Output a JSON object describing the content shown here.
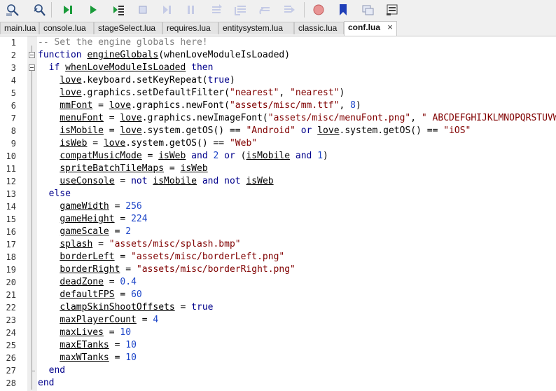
{
  "toolbar": {
    "buttons": [
      "search-icon",
      "find-in-files-icon",
      "run-all-icon",
      "run-icon",
      "run-to-cursor-icon",
      "stop-icon",
      "step-over-icon",
      "pause-icon",
      "step-into-icon",
      "step-out-icon",
      "step-back-icon",
      "step-forward-icon",
      "breakpoint-icon",
      "bookmark-icon",
      "watch-icon",
      "stack-icon"
    ]
  },
  "tabs": [
    {
      "label": "main.lua",
      "active": false
    },
    {
      "label": "console.lua",
      "active": false
    },
    {
      "label": "stageSelect.lua",
      "active": false
    },
    {
      "label": "requires.lua",
      "active": false
    },
    {
      "label": "entitysystem.lua",
      "active": false
    },
    {
      "label": "classic.lua",
      "active": false
    },
    {
      "label": "conf.lua",
      "active": true,
      "close": "×"
    }
  ],
  "editor": {
    "lines": [
      [
        [
          "cmt",
          "-- Set the engine globals here!"
        ]
      ],
      [
        [
          "kw",
          "function"
        ],
        [
          "t",
          " "
        ],
        [
          "var",
          "engineGlobals"
        ],
        [
          "t",
          "(whenLoveModuleIsLoaded)"
        ]
      ],
      [
        [
          "t",
          "  "
        ],
        [
          "kw",
          "if"
        ],
        [
          "t",
          " "
        ],
        [
          "var",
          "whenLoveModuleIsLoaded"
        ],
        [
          "t",
          " "
        ],
        [
          "kw",
          "then"
        ]
      ],
      [
        [
          "t",
          "    "
        ],
        [
          "var",
          "love"
        ],
        [
          "t",
          ".keyboard.setKeyRepeat("
        ],
        [
          "kw",
          "true"
        ],
        [
          "t",
          ")"
        ]
      ],
      [
        [
          "t",
          "    "
        ],
        [
          "var",
          "love"
        ],
        [
          "t",
          ".graphics.setDefaultFilter("
        ],
        [
          "str",
          "\"nearest\""
        ],
        [
          "t",
          ", "
        ],
        [
          "str",
          "\"nearest\""
        ],
        [
          "t",
          ")"
        ]
      ],
      [
        [
          "t",
          "    "
        ],
        [
          "var",
          "mmFont"
        ],
        [
          "t",
          " = "
        ],
        [
          "var",
          "love"
        ],
        [
          "t",
          ".graphics.newFont("
        ],
        [
          "str",
          "\"assets/misc/mm.ttf\""
        ],
        [
          "t",
          ", "
        ],
        [
          "num",
          "8"
        ],
        [
          "t",
          ")"
        ]
      ],
      [
        [
          "t",
          "    "
        ],
        [
          "var",
          "menuFont"
        ],
        [
          "t",
          " = "
        ],
        [
          "var",
          "love"
        ],
        [
          "t",
          ".graphics.newImageFont("
        ],
        [
          "str",
          "\"assets/misc/menuFont.png\""
        ],
        [
          "t",
          ", "
        ],
        [
          "str",
          "\" ABCDEFGHIJKLMNOPQRSTUVWXYZ"
        ]
      ],
      [
        [
          "t",
          "    "
        ],
        [
          "var",
          "isMobile"
        ],
        [
          "t",
          " = "
        ],
        [
          "var",
          "love"
        ],
        [
          "t",
          ".system.getOS() == "
        ],
        [
          "str",
          "\"Android\""
        ],
        [
          "t",
          " "
        ],
        [
          "kw",
          "or"
        ],
        [
          "t",
          " "
        ],
        [
          "var",
          "love"
        ],
        [
          "t",
          ".system.getOS() == "
        ],
        [
          "str",
          "\"iOS\""
        ]
      ],
      [
        [
          "t",
          "    "
        ],
        [
          "var",
          "isWeb"
        ],
        [
          "t",
          " = "
        ],
        [
          "var",
          "love"
        ],
        [
          "t",
          ".system.getOS() == "
        ],
        [
          "str",
          "\"Web\""
        ]
      ],
      [
        [
          "t",
          "    "
        ],
        [
          "var",
          "compatMusicMode"
        ],
        [
          "t",
          " = "
        ],
        [
          "var",
          "isWeb"
        ],
        [
          "t",
          " "
        ],
        [
          "kw",
          "and"
        ],
        [
          "t",
          " "
        ],
        [
          "num",
          "2"
        ],
        [
          "t",
          " "
        ],
        [
          "kw",
          "or"
        ],
        [
          "t",
          " ("
        ],
        [
          "var",
          "isMobile"
        ],
        [
          "t",
          " "
        ],
        [
          "kw",
          "and"
        ],
        [
          "t",
          " "
        ],
        [
          "num",
          "1"
        ],
        [
          "t",
          ")"
        ]
      ],
      [
        [
          "t",
          "    "
        ],
        [
          "var",
          "spriteBatchTileMaps"
        ],
        [
          "t",
          " = "
        ],
        [
          "var",
          "isWeb"
        ]
      ],
      [
        [
          "t",
          "    "
        ],
        [
          "var",
          "useConsole"
        ],
        [
          "t",
          " = "
        ],
        [
          "kw",
          "not"
        ],
        [
          "t",
          " "
        ],
        [
          "var",
          "isMobile"
        ],
        [
          "t",
          " "
        ],
        [
          "kw",
          "and"
        ],
        [
          "t",
          " "
        ],
        [
          "kw",
          "not"
        ],
        [
          "t",
          " "
        ],
        [
          "var",
          "isWeb"
        ]
      ],
      [
        [
          "t",
          "  "
        ],
        [
          "kw",
          "else"
        ]
      ],
      [
        [
          "t",
          "    "
        ],
        [
          "var",
          "gameWidth"
        ],
        [
          "t",
          " = "
        ],
        [
          "num",
          "256"
        ]
      ],
      [
        [
          "t",
          "    "
        ],
        [
          "var",
          "gameHeight"
        ],
        [
          "t",
          " = "
        ],
        [
          "num",
          "224"
        ]
      ],
      [
        [
          "t",
          "    "
        ],
        [
          "var",
          "gameScale"
        ],
        [
          "t",
          " = "
        ],
        [
          "num",
          "2"
        ]
      ],
      [
        [
          "t",
          "    "
        ],
        [
          "var",
          "splash"
        ],
        [
          "t",
          " = "
        ],
        [
          "str",
          "\"assets/misc/splash.bmp\""
        ]
      ],
      [
        [
          "t",
          "    "
        ],
        [
          "var",
          "borderLeft"
        ],
        [
          "t",
          " = "
        ],
        [
          "str",
          "\"assets/misc/borderLeft.png\""
        ]
      ],
      [
        [
          "t",
          "    "
        ],
        [
          "var",
          "borderRight"
        ],
        [
          "t",
          " = "
        ],
        [
          "str",
          "\"assets/misc/borderRight.png\""
        ]
      ],
      [
        [
          "t",
          "    "
        ],
        [
          "var",
          "deadZone"
        ],
        [
          "t",
          " = "
        ],
        [
          "num",
          "0.4"
        ]
      ],
      [
        [
          "t",
          "    "
        ],
        [
          "var",
          "defaultFPS"
        ],
        [
          "t",
          " = "
        ],
        [
          "num",
          "60"
        ]
      ],
      [
        [
          "t",
          "    "
        ],
        [
          "var",
          "clampSkinShootOffsets"
        ],
        [
          "t",
          " = "
        ],
        [
          "kw",
          "true"
        ]
      ],
      [
        [
          "t",
          "    "
        ],
        [
          "var",
          "maxPlayerCount"
        ],
        [
          "t",
          " = "
        ],
        [
          "num",
          "4"
        ]
      ],
      [
        [
          "t",
          "    "
        ],
        [
          "var",
          "maxLives"
        ],
        [
          "t",
          " = "
        ],
        [
          "num",
          "10"
        ]
      ],
      [
        [
          "t",
          "    "
        ],
        [
          "var",
          "maxETanks"
        ],
        [
          "t",
          " = "
        ],
        [
          "num",
          "10"
        ]
      ],
      [
        [
          "t",
          "    "
        ],
        [
          "var",
          "maxWTanks"
        ],
        [
          "t",
          " = "
        ],
        [
          "num",
          "10"
        ]
      ],
      [
        [
          "t",
          "  "
        ],
        [
          "kw",
          "end"
        ]
      ],
      [
        [
          "kw",
          "end"
        ]
      ]
    ]
  }
}
